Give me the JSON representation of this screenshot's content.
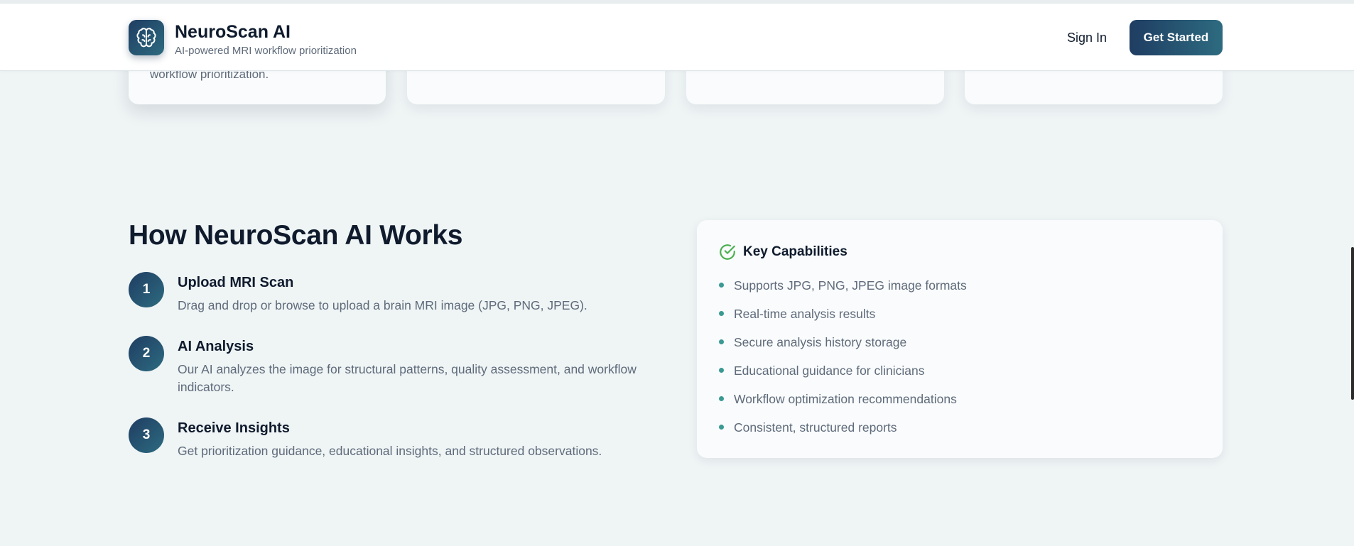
{
  "header": {
    "brand_name": "NeuroScan AI",
    "brand_tagline": "AI-powered MRI workflow prioritization",
    "logo_icon": "brain-icon",
    "sign_in_label": "Sign In",
    "get_started_label": "Get Started"
  },
  "feature_cards": {
    "card1_text": "workflow prioritization."
  },
  "how_it_works": {
    "title": "How NeuroScan AI Works",
    "steps": [
      {
        "number": "1",
        "title": "Upload MRI Scan",
        "description": "Drag and drop or browse to upload a brain MRI image (JPG, PNG, JPEG)."
      },
      {
        "number": "2",
        "title": "AI Analysis",
        "description": "Our AI analyzes the image for structural patterns, quality assessment, and workflow indicators."
      },
      {
        "number": "3",
        "title": "Receive Insights",
        "description": "Get prioritization guidance, educational insights, and structured observations."
      }
    ]
  },
  "capabilities": {
    "icon": "check-circle-icon",
    "title": "Key Capabilities",
    "items": [
      "Supports JPG, PNG, JPEG image formats",
      "Real-time analysis results",
      "Secure analysis history storage",
      "Educational guidance for clinicians",
      "Workflow optimization recommendations",
      "Consistent, structured reports"
    ]
  },
  "colors": {
    "background": "#eff4f5",
    "brand_dark": "#1f3d62",
    "brand_teal": "#2d6b80",
    "bullet": "#3a9a93",
    "check_icon": "#4caf50"
  }
}
